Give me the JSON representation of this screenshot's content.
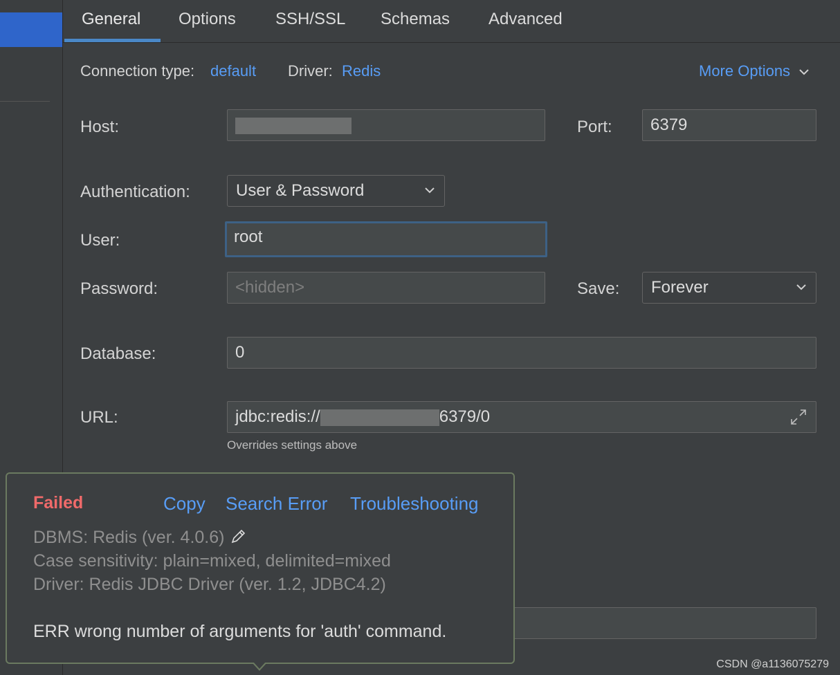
{
  "tabs": [
    "General",
    "Options",
    "SSH/SSL",
    "Schemas",
    "Advanced"
  ],
  "active_tab": "General",
  "connection": {
    "type_label": "Connection type:",
    "type_value": "default",
    "driver_label": "Driver:",
    "driver_value": "Redis",
    "more_options": "More Options"
  },
  "form": {
    "host_label": "Host:",
    "port_label": "Port:",
    "port_value": "6379",
    "auth_label": "Authentication:",
    "auth_value": "User & Password",
    "user_label": "User:",
    "user_value": "root",
    "password_label": "Password:",
    "password_placeholder": "<hidden>",
    "save_label": "Save:",
    "save_value": "Forever",
    "database_label": "Database:",
    "database_value": "0",
    "url_label": "URL:",
    "url_prefix": "jdbc:redis://",
    "url_suffix": "6379/0",
    "url_note": "Overrides settings above"
  },
  "popup": {
    "status": "Failed",
    "copy": "Copy",
    "search_error": "Search Error",
    "troubleshooting": "Troubleshooting",
    "dbms": "DBMS: Redis (ver. 4.0.6)",
    "case_sensitivity": "Case sensitivity: plain=mixed, delimited=mixed",
    "driver": "Driver: Redis JDBC Driver (ver. 1.2, JDBC4.2)",
    "error": "ERR wrong number of arguments for 'auth' command."
  },
  "watermark": "CSDN @a1136075279",
  "icons": {
    "more_options": "chevron-down-icon",
    "combo": "chevron-down-icon",
    "url_expand": "expand-icon",
    "dbms_edit": "pencil-icon"
  },
  "colors": {
    "background": "#3c3f41",
    "link": "#589df6",
    "failed": "#f06a6a",
    "selection": "#2f65ca",
    "focus": "#3d6185"
  }
}
